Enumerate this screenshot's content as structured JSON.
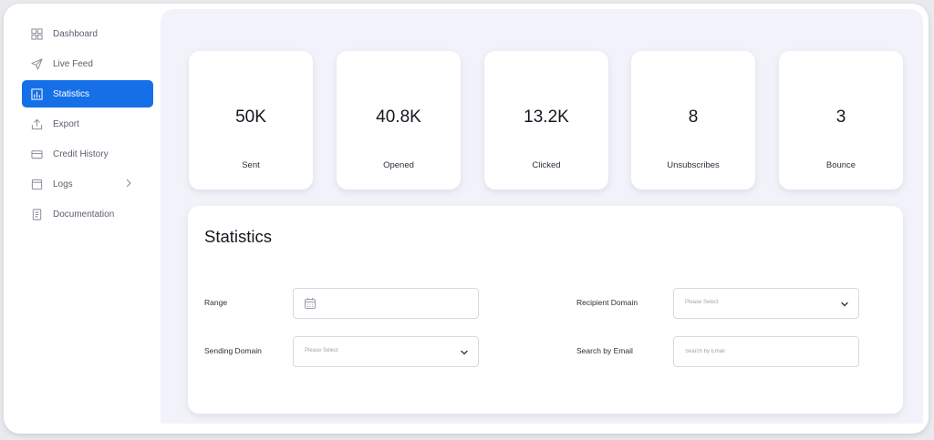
{
  "sidebar": {
    "items": [
      {
        "label": "Dashboard",
        "icon": "grid-icon"
      },
      {
        "label": "Live Feed",
        "icon": "send-icon"
      },
      {
        "label": "Statistics",
        "icon": "bar-chart-icon",
        "active": true
      },
      {
        "label": "Export",
        "icon": "export-icon"
      },
      {
        "label": "Credit History",
        "icon": "credit-card-icon"
      },
      {
        "label": "Logs",
        "icon": "logs-icon",
        "has_submenu": true
      },
      {
        "label": "Documentation",
        "icon": "document-icon"
      }
    ]
  },
  "stats": [
    {
      "value": "50K",
      "label": "Sent"
    },
    {
      "value": "40.8K",
      "label": "Opened"
    },
    {
      "value": "13.2K",
      "label": "Clicked"
    },
    {
      "value": "8",
      "label": "Unsubscribes"
    },
    {
      "value": "3",
      "label": "Bounce"
    }
  ],
  "panel": {
    "title": "Statistics",
    "range_label": "Range",
    "recipient_domain_label": "Recipient Domain",
    "recipient_domain_placeholder": "Please Select",
    "sending_domain_label": "Sending Domain",
    "sending_domain_placeholder": "Please Select",
    "search_email_label": "Search by Email",
    "search_email_placeholder": "Search by Email"
  },
  "colors": {
    "accent": "#1570e8",
    "main_background": "#f2f3fa",
    "card_background": "#ffffff"
  }
}
